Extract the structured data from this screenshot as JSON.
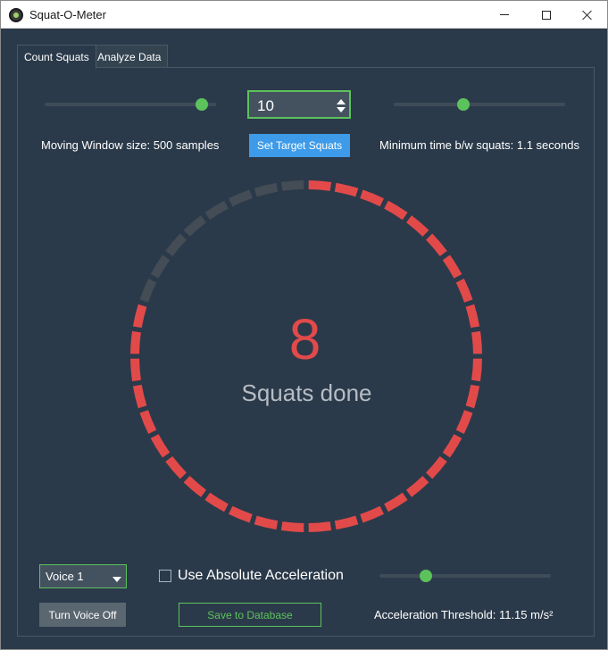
{
  "window": {
    "title": "Squat-O-Meter"
  },
  "tabs": [
    {
      "label": "Count Squats",
      "active": true
    },
    {
      "label": "Analyze Data",
      "active": false
    }
  ],
  "controls": {
    "moving_window": {
      "label": "Moving Window size: 500 samples",
      "slider_level": 0.95
    },
    "target_squats": {
      "value": "10"
    },
    "set_target_button": "Set Target Squats",
    "min_time": {
      "label": "Minimum time b/w squats: 1.1 seconds",
      "slider_level": 0.4
    }
  },
  "progress": {
    "count": "8",
    "label": "Squats done",
    "segments_total": 40,
    "segments_filled": 32,
    "filled_color": "#e24a4a",
    "empty_color": "#444c55"
  },
  "bottom": {
    "voice_select": {
      "value": "Voice 1"
    },
    "abs_accel_checkbox": {
      "label": "Use Absolute Acceleration",
      "checked": false
    },
    "accel_threshold": {
      "label": "Acceleration Threshold: 11.15 m/s²",
      "slider_level": 0.25
    },
    "voice_button": "Turn Voice Off",
    "save_button": "Save to Database"
  },
  "colors": {
    "accent": "#5cc25c",
    "button_blue": "#3d9be9",
    "background": "#2b3a4a"
  }
}
